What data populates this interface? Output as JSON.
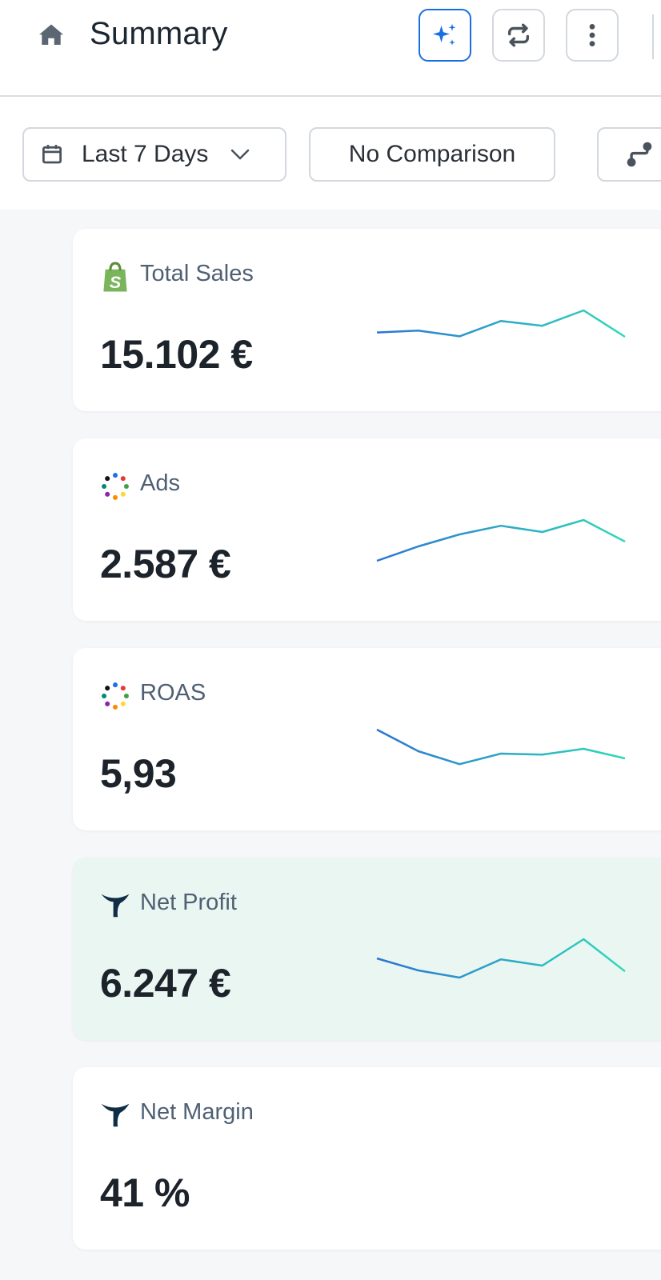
{
  "header": {
    "title": "Summary",
    "icons": [
      "home-icon",
      "sparkles-icon",
      "refresh-icon",
      "more-vertical-icon"
    ]
  },
  "filters": {
    "date_range": "Last 7 Days",
    "comparison": "No Comparison",
    "icons": [
      "calendar-icon",
      "chevron-down-icon",
      "route-icon"
    ]
  },
  "cards": [
    {
      "label": "Total Sales",
      "value": "15.102 €",
      "source_icon": "shopify-icon",
      "highlighted": false,
      "trend": [
        0.54,
        0.58,
        0.46,
        0.78,
        0.68,
        1.0,
        0.45
      ]
    },
    {
      "label": "Ads",
      "value": "2.587 €",
      "source_icon": "dots-circle-icon",
      "highlighted": false,
      "trend": [
        0.15,
        0.45,
        0.7,
        0.88,
        0.75,
        1.0,
        0.55
      ]
    },
    {
      "label": "ROAS",
      "value": "5,93",
      "source_icon": "dots-circle-icon",
      "highlighted": false,
      "trend": [
        1.0,
        0.55,
        0.28,
        0.5,
        0.48,
        0.6,
        0.4
      ]
    },
    {
      "label": "Net Profit",
      "value": "6.247 €",
      "source_icon": "triple-whale-icon",
      "highlighted": true,
      "trend": [
        0.6,
        0.35,
        0.2,
        0.58,
        0.45,
        1.0,
        0.33
      ]
    },
    {
      "label": "Net Margin",
      "value": "41 %",
      "source_icon": "triple-whale-icon",
      "highlighted": false,
      "trend": []
    }
  ],
  "colors": {
    "accent": "#1a6fe0",
    "spark_start": "#2b74d4",
    "spark_end": "#2fd9b8",
    "highlight_bg": "#eaf6f2"
  }
}
